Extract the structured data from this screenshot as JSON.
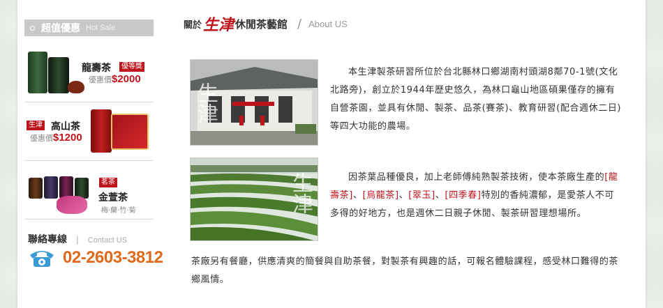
{
  "sidebar": {
    "sale_title": "超值優惠",
    "sale_title_en": "Hot Sale",
    "products": [
      {
        "name": "龍壽茶",
        "badge": "優等獎",
        "price_label": "優惠價",
        "price": "$2000"
      },
      {
        "name": "高山茶",
        "badge": "生津",
        "price_label": "優惠價",
        "price": "$1200"
      },
      {
        "name": "金萱茶",
        "badge": "茗茶",
        "subtitle": "梅·蘭·竹·菊"
      }
    ],
    "contact": {
      "title": "聯絡專線",
      "separator": "|",
      "title_en": "Contact US",
      "phone": "02-2603-3812"
    }
  },
  "main": {
    "heading": {
      "prefix": "關於",
      "brand": "生津",
      "title": "休閒茶藝館",
      "slash": "/",
      "title_en": "About US"
    },
    "photo_watermark": "生津",
    "para1": "本生津製茶研習所位於台北縣林口鄉湖南村頭湖8鄰70-1號(文化北路旁)，創立於1944年歷史悠久，為林口龜山地區碩果僅存的擁有自營茶園，並具有休閒、製茶、品茶(賽茶)、教育研習(配合週休二日)等四大功能的農場。",
    "para2": {
      "intro": "因茶葉品種優良，加上老師傅純熟製茶技術，使本茶廠生產的",
      "tea1": "[龍壽茶]",
      "sep1": "、",
      "tea2": "[烏龍茶]",
      "sep2": "、",
      "tea3": "[翠玉]",
      "sep3": "、",
      "tea4": "[四季春]",
      "outro": "特別的香純濃郁，是愛茶人不可多得的好地方，也是週休二日親子休閒、製茶研習理想場所。"
    },
    "para3": "茶廠另有餐廳，供應清爽的簡餐與自助茶餐，對製茶有興趣的話，可報名體驗課程，感受林口難得的茶鄉風情。"
  },
  "colors": {
    "accent_red": "#c0141c",
    "phone_orange": "#e06a1a",
    "header_gray": "#c9c9c9",
    "background_green": "#e4ebe3"
  },
  "icons": [
    "telephone-icon"
  ]
}
